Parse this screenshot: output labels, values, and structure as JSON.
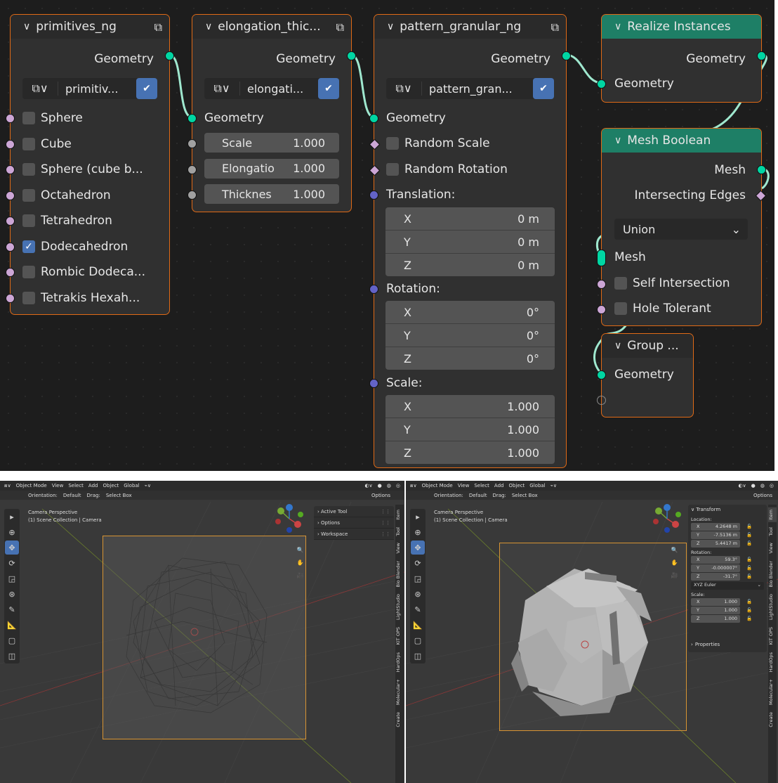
{
  "colors": {
    "editor_bg": "#1d1d1d",
    "node_bg": "#303030",
    "node_border": "#e06a16",
    "geometry_socket": "#00d6a3",
    "bool_socket": "#cca6d6",
    "vector_socket": "#6363c7",
    "value_socket": "#a1a1a1",
    "green_header": "#1e7f66",
    "accent": "#4772b3"
  },
  "nodes": {
    "primitives": {
      "title": "primitives_ng",
      "output": "Geometry",
      "group_name": "primitiv...",
      "options": [
        {
          "label": "Sphere",
          "checked": false
        },
        {
          "label": "Cube",
          "checked": false
        },
        {
          "label": "Sphere (cube b...",
          "checked": false
        },
        {
          "label": "Octahedron",
          "checked": false
        },
        {
          "label": "Tetrahedron",
          "checked": false
        },
        {
          "label": "Dodecahedron",
          "checked": true
        },
        {
          "label": "Rombic Dodeca...",
          "checked": false
        },
        {
          "label": "Tetrakis Hexah...",
          "checked": false
        }
      ]
    },
    "elongation": {
      "title": "elongation_thic...",
      "output": "Geometry",
      "group_name": "elongati...",
      "input": "Geometry",
      "fields": [
        {
          "label": "Scale",
          "value": "1.000"
        },
        {
          "label": "Elongatio",
          "value": "1.000"
        },
        {
          "label": "Thicknes",
          "value": "1.000"
        }
      ]
    },
    "pattern": {
      "title": "pattern_granular_ng",
      "output": "Geometry",
      "group_name": "pattern_gran...",
      "input": "Geometry",
      "random_scale": "Random Scale",
      "random_rotation": "Random Rotation",
      "translation_label": "Translation:",
      "translation": [
        {
          "axis": "X",
          "value": "0 m"
        },
        {
          "axis": "Y",
          "value": "0 m"
        },
        {
          "axis": "Z",
          "value": "0 m"
        }
      ],
      "rotation_label": "Rotation:",
      "rotation": [
        {
          "axis": "X",
          "value": "0°"
        },
        {
          "axis": "Y",
          "value": "0°"
        },
        {
          "axis": "Z",
          "value": "0°"
        }
      ],
      "scale_label": "Scale:",
      "scale": [
        {
          "axis": "X",
          "value": "1.000"
        },
        {
          "axis": "Y",
          "value": "1.000"
        },
        {
          "axis": "Z",
          "value": "1.000"
        }
      ]
    },
    "realize": {
      "title": "Realize Instances",
      "output": "Geometry",
      "input": "Geometry"
    },
    "boolean": {
      "title": "Mesh Boolean",
      "output": "Mesh",
      "output2": "Intersecting Edges",
      "operation": "Union",
      "input": "Mesh",
      "self_intersection": "Self Intersection",
      "hole_tolerant": "Hole Tolerant"
    },
    "group_output": {
      "title": "Group ...",
      "input": "Geometry"
    }
  },
  "viewport": {
    "header": {
      "mode": "Object Mode",
      "menus": [
        "View",
        "Select",
        "Add",
        "Object"
      ],
      "transform_space": "Global",
      "orientation_label": "Orientation:",
      "orientation_value": "Default",
      "drag_label": "Drag:",
      "drag_value": "Select Box",
      "options": "Options"
    },
    "info_line1": "Camera Perspective",
    "info_line2": "(1) Scene Collection | Camera",
    "left_popovers": [
      "Active Tool",
      "Options",
      "Workspace"
    ],
    "left_tabs": [
      "Item",
      "Tool",
      "View",
      "Bio Blender",
      "LightStudio",
      "KIT OPS",
      "HardOps",
      "Molecular+",
      "Create"
    ],
    "right_tabs": [
      "Item",
      "Tool",
      "View",
      "Bio Blender",
      "LightStudio",
      "KIT OPS",
      "HardOps",
      "Molecular+",
      "Create"
    ],
    "transform": {
      "title": "Transform",
      "location_label": "Location:",
      "location": [
        {
          "axis": "X",
          "value": "4.2648 m"
        },
        {
          "axis": "Y",
          "value": "-7.5136 m"
        },
        {
          "axis": "Z",
          "value": "5.4417 m"
        }
      ],
      "rotation_label": "Rotation:",
      "rotation": [
        {
          "axis": "X",
          "value": "59.3°"
        },
        {
          "axis": "Y",
          "value": "-0.000007°"
        },
        {
          "axis": "Z",
          "value": "-31.7°"
        }
      ],
      "rotation_mode": "XYZ Euler",
      "scale_label": "Scale:",
      "scale": [
        {
          "axis": "X",
          "value": "1.000"
        },
        {
          "axis": "Y",
          "value": "1.000"
        },
        {
          "axis": "Z",
          "value": "1.000"
        }
      ],
      "properties": "Properties"
    },
    "gizmo": {
      "x": "X",
      "y": "Y",
      "z": "Z"
    }
  }
}
